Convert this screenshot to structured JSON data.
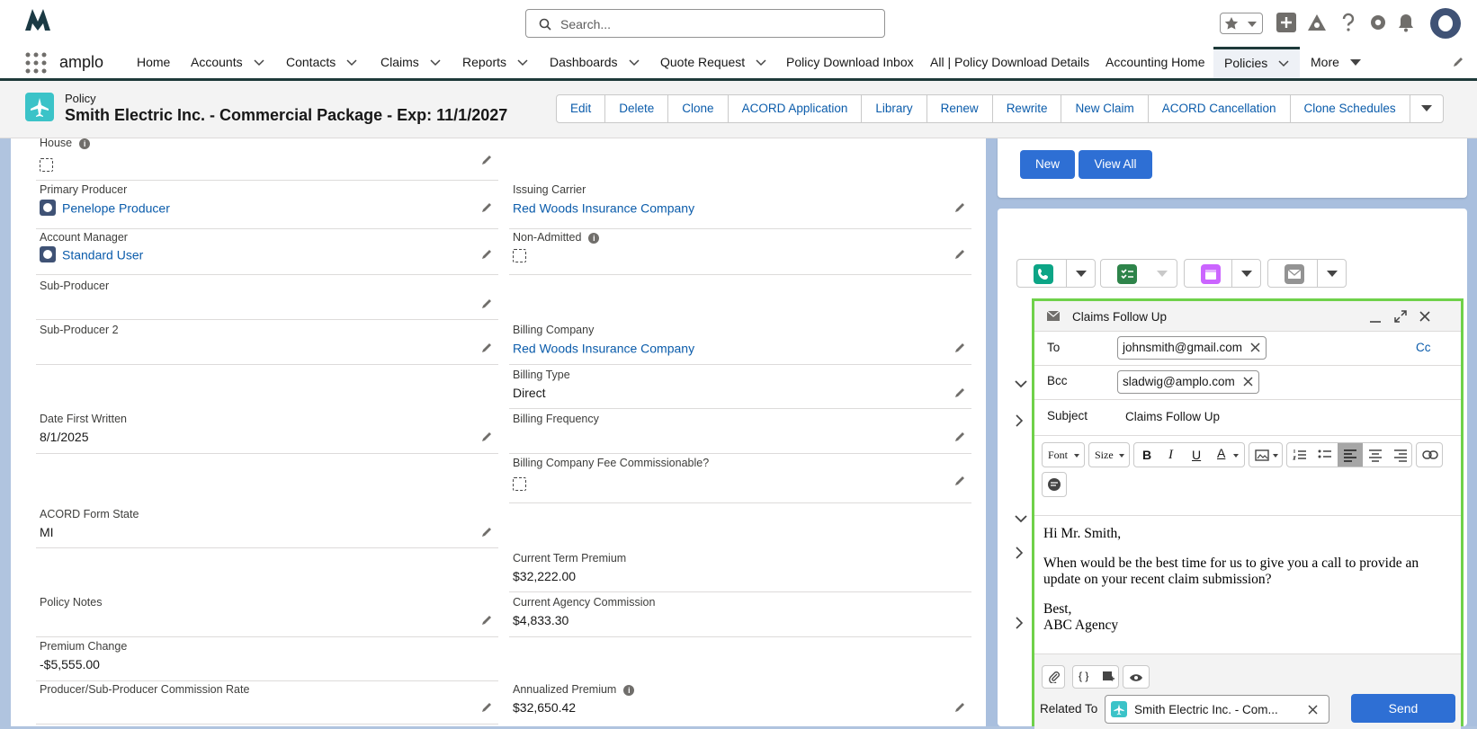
{
  "search": {
    "placeholder": "Search..."
  },
  "nav": {
    "app_name": "amplo",
    "items": [
      {
        "label": "Home",
        "chevron": false
      },
      {
        "label": "Accounts",
        "chevron": true
      },
      {
        "label": "Contacts",
        "chevron": true
      },
      {
        "label": "Claims",
        "chevron": true
      },
      {
        "label": "Reports",
        "chevron": true
      },
      {
        "label": "Dashboards",
        "chevron": true
      },
      {
        "label": "Quote Request",
        "chevron": true
      },
      {
        "label": "Policy Download Inbox",
        "chevron": false
      },
      {
        "label": "All | Policy Download Details",
        "chevron": false
      },
      {
        "label": "Accounting Home",
        "chevron": false
      },
      {
        "label": "Policies",
        "chevron": true,
        "active": true
      },
      {
        "label": "More",
        "chevron": true
      }
    ]
  },
  "header": {
    "object_type": "Policy",
    "record_name": "Smith Electric Inc. - Commercial Package - Exp: 11/1/2027",
    "actions": [
      "Edit",
      "Delete",
      "Clone",
      "ACORD Application",
      "Library",
      "Renew",
      "Rewrite",
      "New Claim",
      "ACORD Cancellation",
      "Clone Schedules"
    ]
  },
  "fields": {
    "house": {
      "label": "House"
    },
    "primary_producer": {
      "label": "Primary Producer",
      "value": "Penelope Producer"
    },
    "issuing_carrier": {
      "label": "Issuing Carrier",
      "value": "Red Woods Insurance Company"
    },
    "account_manager": {
      "label": "Account Manager",
      "value": "Standard User"
    },
    "non_admitted": {
      "label": "Non-Admitted"
    },
    "sub_producer": {
      "label": "Sub-Producer"
    },
    "sub_producer_2": {
      "label": "Sub-Producer 2"
    },
    "billing_company": {
      "label": "Billing Company",
      "value": "Red Woods Insurance Company"
    },
    "billing_type": {
      "label": "Billing Type",
      "value": "Direct"
    },
    "date_first_written": {
      "label": "Date First Written",
      "value": "8/1/2025"
    },
    "billing_frequency": {
      "label": "Billing Frequency"
    },
    "billing_fee_commissionable": {
      "label": "Billing Company Fee Commissionable?"
    },
    "acord_form_state": {
      "label": "ACORD Form State",
      "value": "MI"
    },
    "current_term_premium": {
      "label": "Current Term Premium",
      "value": "$32,222.00"
    },
    "policy_notes": {
      "label": "Policy Notes"
    },
    "current_agency_commission": {
      "label": "Current Agency Commission",
      "value": "$4,833.30"
    },
    "premium_change": {
      "label": "Premium Change",
      "value": "-$5,555.00"
    },
    "producer_commission_rate": {
      "label": "Producer/Sub-Producer Commission Rate"
    },
    "annualized_premium": {
      "label": "Annualized Premium",
      "value": "$32,650.42"
    }
  },
  "related": {
    "new_label": "New",
    "view_all_label": "View All"
  },
  "activity": {
    "icons": [
      "phone-icon",
      "task-icon",
      "calendar-icon",
      "email-icon"
    ]
  },
  "composer": {
    "title": "Claims Follow Up",
    "to_label": "To",
    "to_value": "johnsmith@gmail.com",
    "cc_label": "Cc",
    "bcc_label": "Bcc",
    "bcc_value": "sladwig@amplo.com",
    "subject_label": "Subject",
    "subject_value": "Claims Follow Up",
    "font_label": "Font",
    "size_label": "Size",
    "body": [
      "Hi Mr. Smith,",
      "When would be the best time for us to give you a call to provide an update on your recent claim submission?",
      "Best,",
      "ABC Agency"
    ],
    "related_to_label": "Related To",
    "related_to_value": "Smith Electric Inc. - Com...",
    "send_label": "Send"
  },
  "colors": {
    "accent": "#0b5cab",
    "button": "#2e6fd4",
    "highlight": "#6fd14a",
    "nav_border": "#1e3a3a",
    "policy_icon": "#3bc3c8"
  }
}
